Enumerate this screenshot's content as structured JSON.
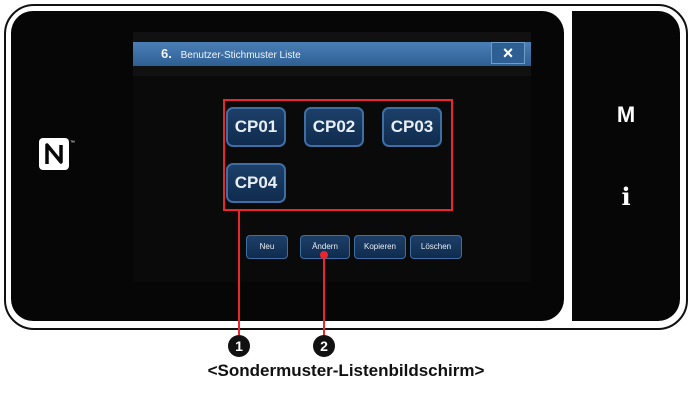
{
  "dialog": {
    "number": "6.",
    "title": "Benutzer-Stichmuster Liste",
    "close_symbol": "×"
  },
  "patterns": [
    "CP01",
    "CP02",
    "CP03",
    "CP04"
  ],
  "actions": {
    "new": "Neu",
    "change": "Ändern",
    "copy": "Kopieren",
    "delete": "Löschen"
  },
  "side": {
    "mode": "M",
    "info": "i"
  },
  "markers": {
    "one": "1",
    "two": "2"
  },
  "caption": "<Sondermuster-Listenbildschirm>",
  "icons": {
    "nfc": "nfc-icon",
    "close": "close-icon"
  },
  "colors": {
    "highlight": "#e8262b",
    "title_bar": "#2e5f93",
    "button": "#1d3f68"
  }
}
